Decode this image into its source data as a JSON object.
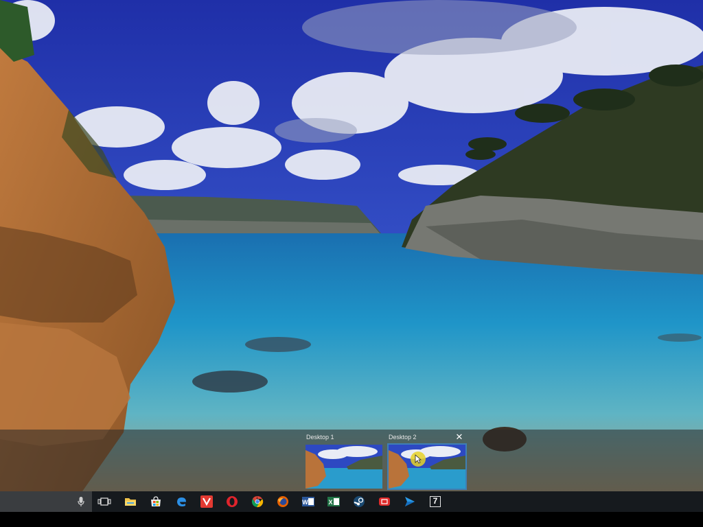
{
  "task_view": {
    "desktops": [
      {
        "label": "Desktop 1"
      },
      {
        "label": "Desktop 2"
      }
    ],
    "close_glyph": "✕"
  },
  "taskbar": {
    "icons": [
      "task-view-icon",
      "file-explorer-icon",
      "store-icon",
      "edge-icon",
      "vivaldi-icon",
      "opera-icon",
      "chrome-icon",
      "firefox-icon",
      "word-icon",
      "excel-icon",
      "steam-icon",
      "video-app-icon",
      "arrow-app-icon",
      "seven-app-icon"
    ],
    "seven_label": "7"
  }
}
